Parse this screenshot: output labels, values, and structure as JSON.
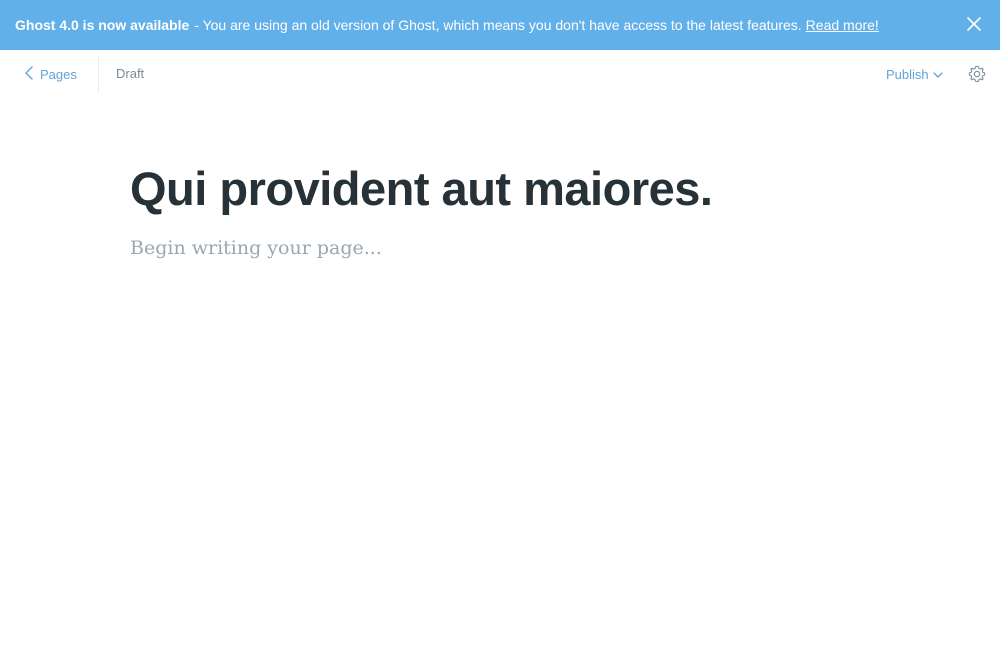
{
  "banner": {
    "headline": "Ghost 4.0 is now available",
    "message": "- You are using an old version of Ghost, which means you don't have access to the latest features.",
    "link_label": "Read more!",
    "close_icon": "close-icon",
    "color": "#62b0ea"
  },
  "header": {
    "back_label": "Pages",
    "back_icon": "chevron-left-icon",
    "status": "Draft",
    "publish_label": "Publish",
    "publish_icon": "chevron-down-icon",
    "settings_icon": "gear-icon",
    "accent_color": "#5ea4d9"
  },
  "editor": {
    "title": "Qui provident aut maiores.",
    "body_placeholder": "Begin writing your page..."
  }
}
